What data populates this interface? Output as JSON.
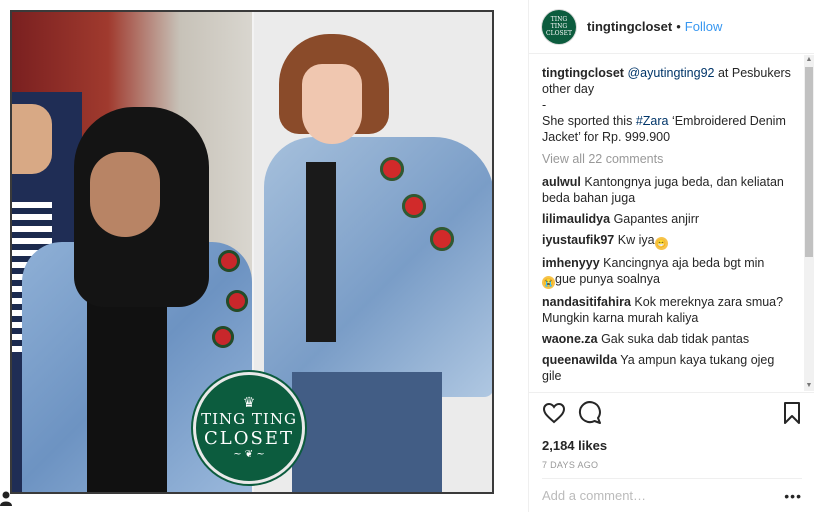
{
  "post": {
    "logo_line1": "TING TING",
    "logo_line2": "CLOSET"
  },
  "header": {
    "avatar_text": "TING TING CLOSET",
    "username": "tingtingcloset",
    "separator": "•",
    "follow_label": "Follow"
  },
  "caption": {
    "username": "tingtingcloset",
    "mention": "@ayutingting92",
    "text1": " at Pesbukers other day",
    "dash": "-",
    "text2": "She sported this ",
    "hashtag": "#Zara",
    "text3": " ‘Embroidered Denim Jacket’ for Rp. 999.900"
  },
  "view_all": "View all 22 comments",
  "comments": [
    {
      "user": "aulwul",
      "text": "Kantongnya juga beda, dan keliatan beda bahan juga",
      "emoji": ""
    },
    {
      "user": "lilimaulidya",
      "text": "Gapantes anjirr",
      "emoji": ""
    },
    {
      "user": "iyustaufik97",
      "text": "Kw iya",
      "emoji": "😁"
    },
    {
      "user": "imhenyyy",
      "text": "Kancingnya aja beda bgt min",
      "emoji_pre": "😭",
      "text2": "gue punya soalnya"
    },
    {
      "user": "nandasitifahira",
      "text": "Kok mereknya zara smua? Mungkin karna murah kaliya",
      "emoji": ""
    },
    {
      "user": "waone.za",
      "text": "Gak suka dab tidak pantas",
      "emoji": ""
    },
    {
      "user": "queenawilda",
      "text": "Ya ampun kaya tukang ojeg gile",
      "emoji": ""
    }
  ],
  "icons": {
    "like": "heart-icon",
    "comment": "comment-icon",
    "save": "bookmark-icon",
    "more": "more-options-icon"
  },
  "likes": "2,184 likes",
  "timestamp": "7 DAYS AGO",
  "add_comment": {
    "placeholder": "Add a comment…",
    "more_symbol": "•••"
  },
  "colors": {
    "link": "#3897f0",
    "brand_green": "#0c5c3e"
  }
}
